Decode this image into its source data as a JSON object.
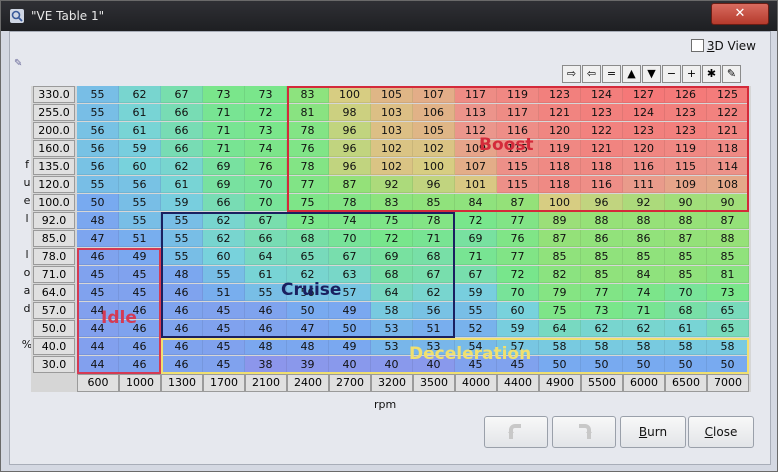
{
  "window": {
    "title": "\"VE Table 1\"",
    "close_glyph": "✕"
  },
  "options": {
    "view3d_label_prefix": "3",
    "view3d_label_suffix": "D View",
    "view3d_checked": false
  },
  "toolbar": {
    "buttons": [
      {
        "name": "shift-right-button",
        "glyph": "⇨"
      },
      {
        "name": "shift-left-button",
        "glyph": "⇦"
      },
      {
        "name": "set-equal-button",
        "glyph": "="
      },
      {
        "name": "increment-button",
        "glyph": "▲"
      },
      {
        "name": "decrement-button",
        "glyph": "▼"
      },
      {
        "name": "subtract-button",
        "glyph": "−"
      },
      {
        "name": "add-button",
        "glyph": "+"
      },
      {
        "name": "multiply-button",
        "glyph": "✱"
      },
      {
        "name": "pen-button",
        "glyph": "✎"
      }
    ]
  },
  "table": {
    "y_axis_title": "fuel load %",
    "x_axis_title": "rpm",
    "y_labels": [
      "330.0",
      "255.0",
      "200.0",
      "160.0",
      "135.0",
      "120.0",
      "100.0",
      "92.0",
      "85.0",
      "78.0",
      "71.0",
      "64.0",
      "57.0",
      "50.0",
      "40.0",
      "30.0"
    ],
    "x_labels": [
      "600",
      "1000",
      "1300",
      "1700",
      "2100",
      "2400",
      "2700",
      "3200",
      "3500",
      "4000",
      "4400",
      "4900",
      "5500",
      "6000",
      "6500",
      "7000"
    ],
    "rows": [
      [
        55,
        62,
        67,
        73,
        73,
        83,
        100,
        105,
        107,
        117,
        119,
        123,
        124,
        127,
        126,
        125
      ],
      [
        55,
        61,
        66,
        71,
        72,
        81,
        98,
        103,
        106,
        113,
        117,
        121,
        123,
        124,
        123,
        122
      ],
      [
        56,
        61,
        66,
        71,
        73,
        78,
        96,
        103,
        105,
        112,
        116,
        120,
        122,
        123,
        123,
        121
      ],
      [
        56,
        59,
        66,
        71,
        74,
        76,
        96,
        102,
        102,
        109,
        115,
        119,
        121,
        120,
        119,
        118
      ],
      [
        56,
        60,
        62,
        69,
        76,
        78,
        96,
        102,
        100,
        107,
        115,
        118,
        118,
        116,
        115,
        114
      ],
      [
        55,
        56,
        61,
        69,
        70,
        77,
        87,
        92,
        96,
        101,
        115,
        118,
        116,
        111,
        109,
        108
      ],
      [
        50,
        55,
        59,
        66,
        70,
        75,
        78,
        83,
        85,
        84,
        87,
        100,
        96,
        92,
        90,
        90
      ],
      [
        48,
        55,
        55,
        62,
        67,
        73,
        74,
        75,
        78,
        72,
        77,
        89,
        88,
        88,
        88,
        87
      ],
      [
        47,
        51,
        55,
        62,
        66,
        68,
        70,
        72,
        71,
        69,
        76,
        87,
        86,
        86,
        87,
        88
      ],
      [
        46,
        49,
        55,
        60,
        64,
        65,
        67,
        69,
        68,
        71,
        77,
        85,
        85,
        85,
        85,
        85
      ],
      [
        45,
        45,
        48,
        55,
        61,
        62,
        63,
        68,
        67,
        67,
        72,
        82,
        85,
        84,
        85,
        81
      ],
      [
        45,
        45,
        46,
        51,
        55,
        56,
        57,
        64,
        62,
        59,
        70,
        79,
        77,
        74,
        70,
        73
      ],
      [
        44,
        46,
        46,
        45,
        46,
        50,
        49,
        58,
        56,
        55,
        60,
        75,
        73,
        71,
        68,
        65
      ],
      [
        44,
        46,
        46,
        45,
        46,
        47,
        50,
        53,
        51,
        52,
        59,
        64,
        62,
        62,
        61,
        65
      ],
      [
        44,
        46,
        46,
        45,
        48,
        48,
        49,
        53,
        53,
        54,
        57,
        58,
        58,
        58,
        58,
        58
      ],
      [
        44,
        46,
        46,
        45,
        38,
        39,
        40,
        40,
        40,
        45,
        45,
        50,
        50,
        50,
        50,
        50
      ]
    ]
  },
  "regions": [
    {
      "label": "Boost",
      "color": "#d42a3a"
    },
    {
      "label": "Cruise",
      "color": "#1a2060"
    },
    {
      "label": "Idle",
      "color": "#d43a54"
    },
    {
      "label": "Deceleration",
      "color": "#f0e070"
    }
  ],
  "buttons": {
    "burn_prefix": "B",
    "burn_suffix": "urn",
    "close_prefix": "C",
    "close_suffix": "lose"
  }
}
